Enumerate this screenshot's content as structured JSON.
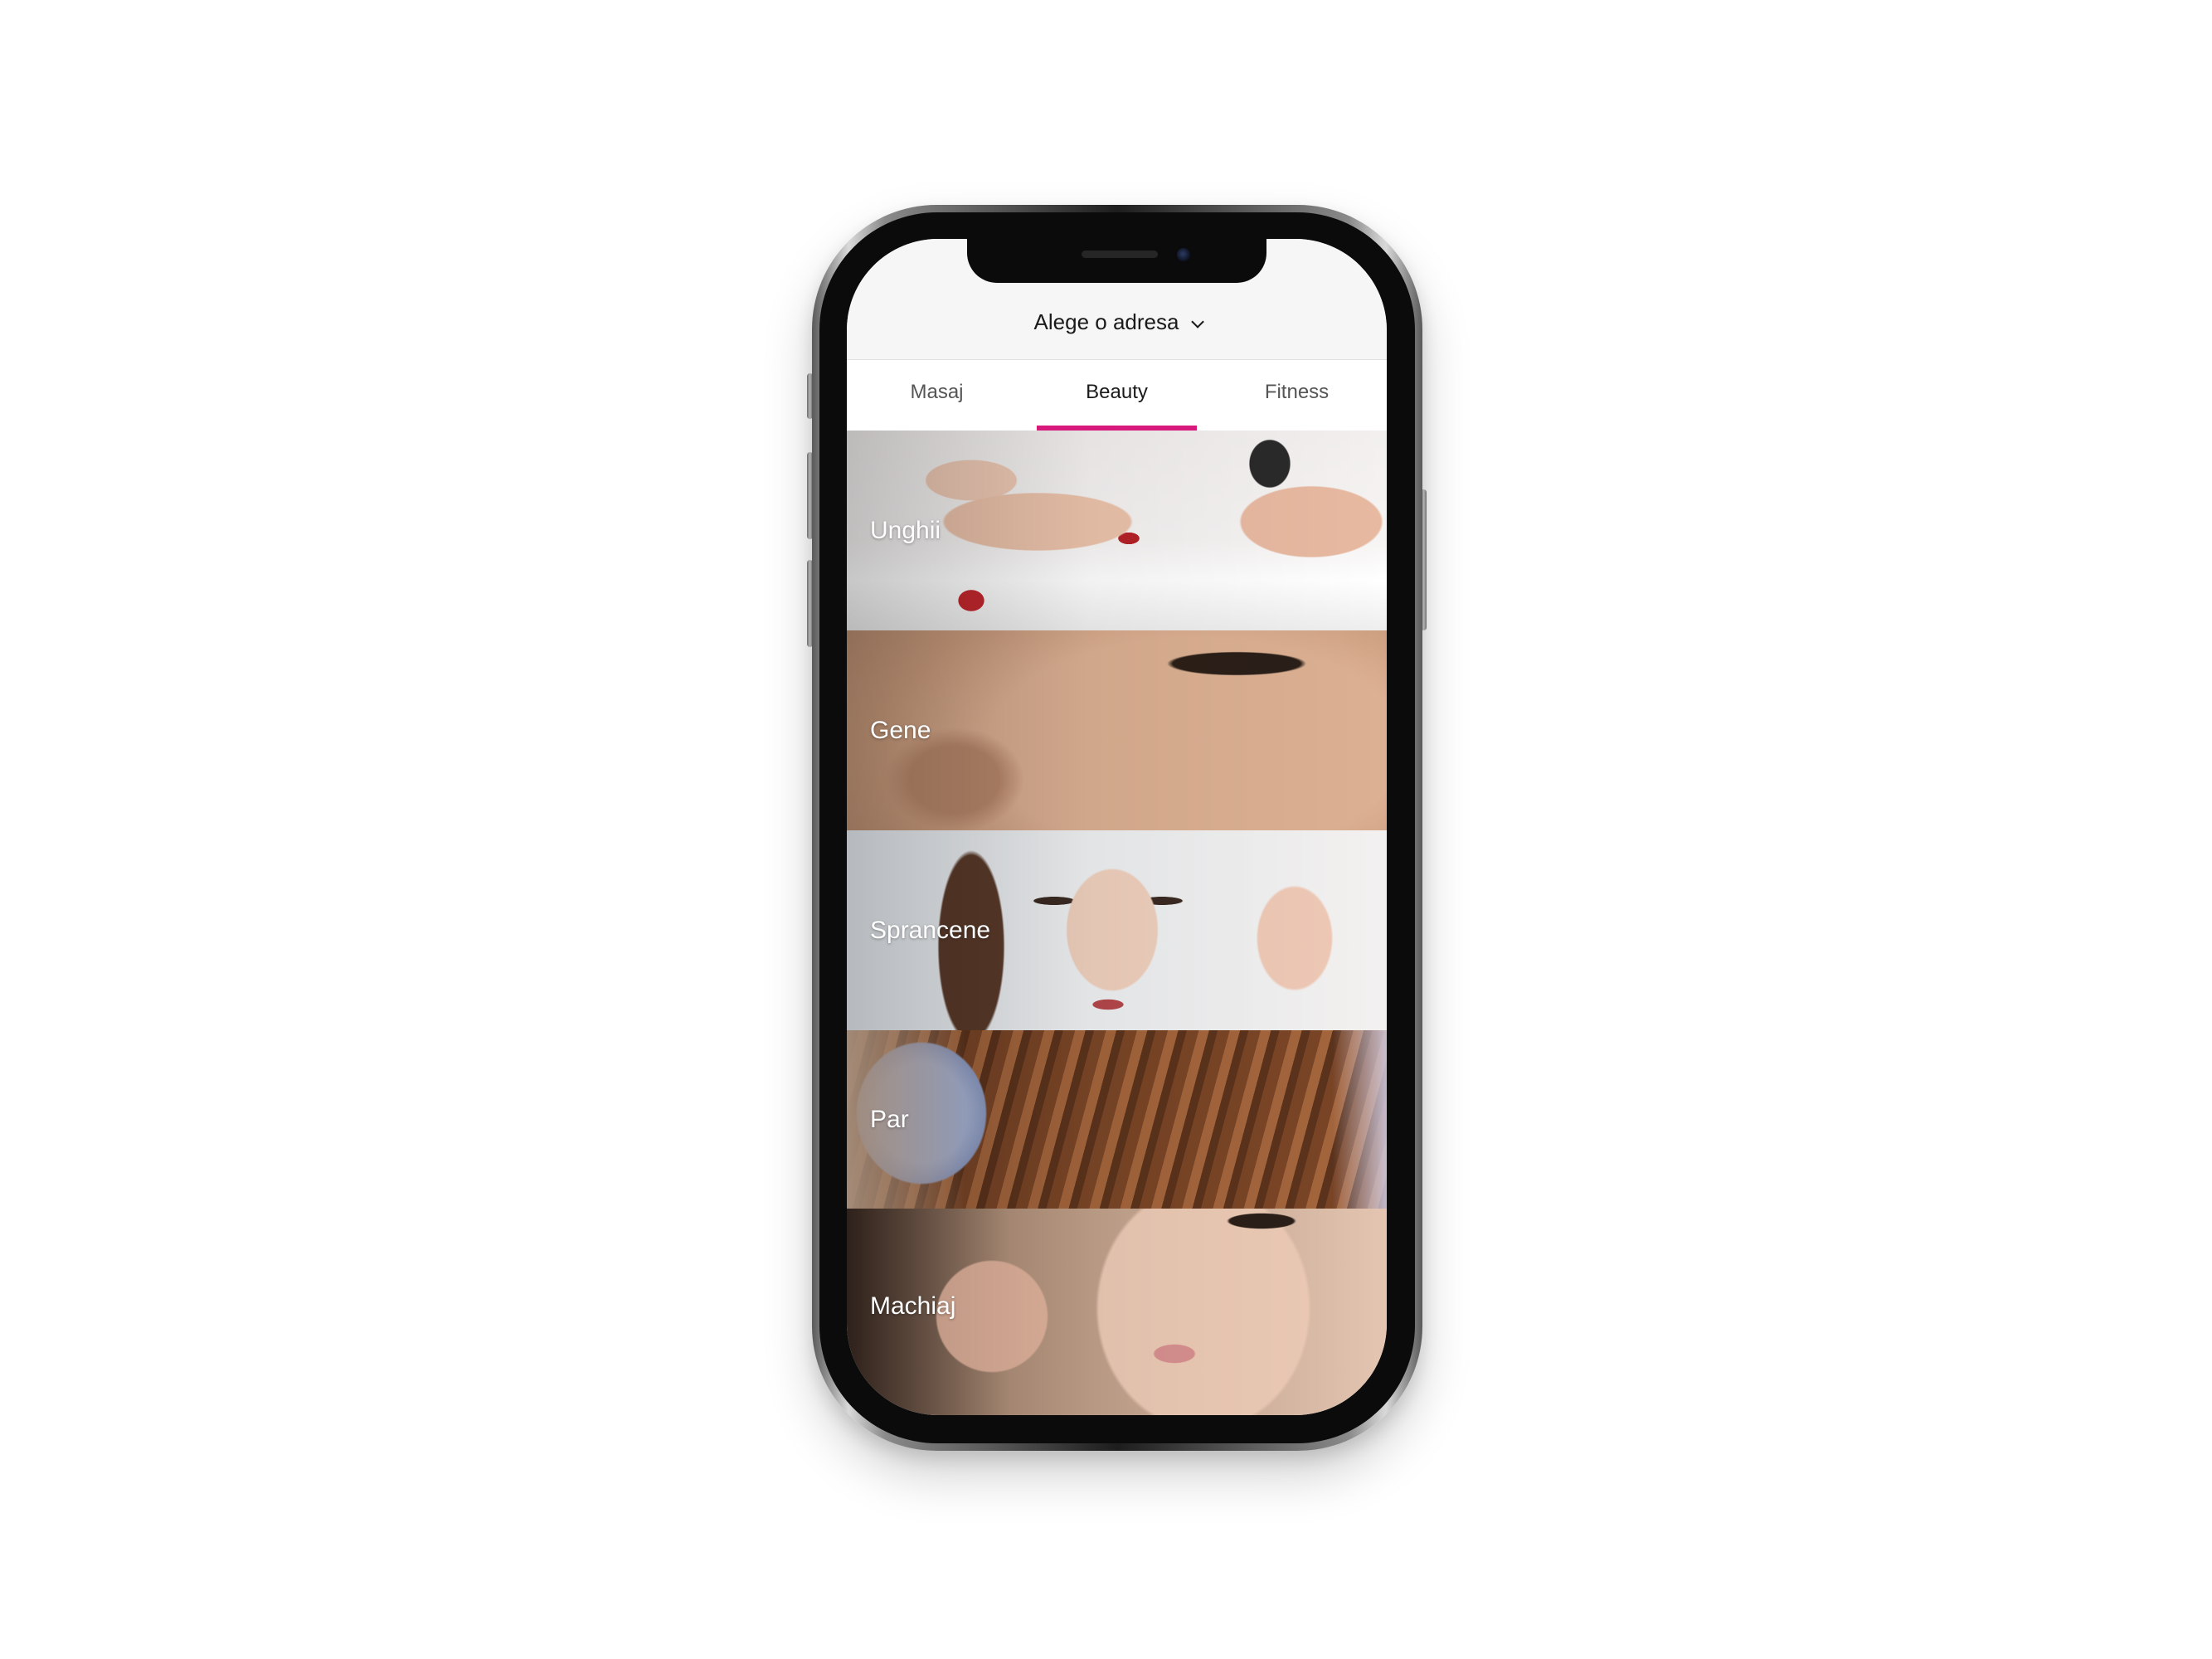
{
  "header": {
    "address_label": "Alege o adresa"
  },
  "tabs": [
    {
      "label": "Masaj",
      "active": false
    },
    {
      "label": "Beauty",
      "active": true
    },
    {
      "label": "Fitness",
      "active": false
    }
  ],
  "categories": [
    {
      "label": "Unghii"
    },
    {
      "label": "Gene"
    },
    {
      "label": "Sprancene"
    },
    {
      "label": "Par"
    },
    {
      "label": "Machiaj"
    }
  ],
  "colors": {
    "accent": "#d6197a",
    "header_bg": "#f6f6f6",
    "tab_bg": "#ffffff",
    "text": "#1a1a1a",
    "label_text": "#ffffff"
  },
  "icons": {
    "address_chevron": "chevron-down-icon"
  }
}
